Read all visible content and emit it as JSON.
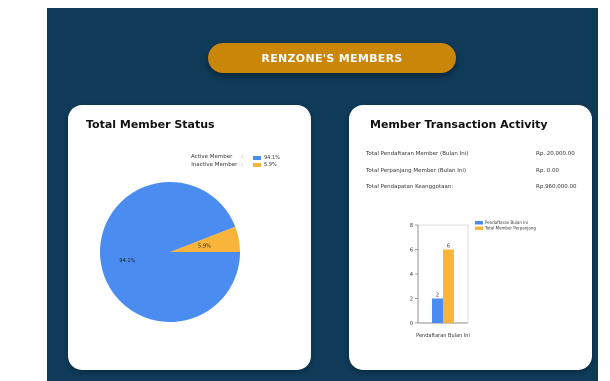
{
  "header": {
    "title": "RENZONE'S MEMBERS"
  },
  "member_status": {
    "title": "Total Member Status",
    "legend": [
      {
        "label": "Active Member",
        "separator": ":",
        "value_label": "94.1%",
        "color": "#4a8cf0"
      },
      {
        "label": "Inactive Member",
        "separator": ":",
        "value_label": "5.9%",
        "color": "#f9b43c"
      }
    ]
  },
  "transactions": {
    "title": "Member Transaction Activity",
    "rows": [
      {
        "label": "Total Pendaftaran Member (Bulan Ini)",
        "value": "Rp. 20,000.00"
      },
      {
        "label": "Total Perpanjang Member (Bulan Ini)",
        "value": "Rp. 0.00"
      },
      {
        "label": "Total Pendapatan Keanggotaan:",
        "value": "Rp.960,000.00"
      }
    ],
    "legend": [
      {
        "name": "Pendaftaran Bulan Ini",
        "color": "#4a8cf0"
      },
      {
        "name": "Total Member Perpanjang",
        "color": "#f9b43c"
      }
    ]
  },
  "chart_data": [
    {
      "type": "pie",
      "slices": [
        {
          "label": "Active Member",
          "value": 94.1,
          "color": "#4a8cf0",
          "data_label": "94.1%"
        },
        {
          "label": "Inactive Member",
          "value": 5.9,
          "color": "#f9b43c",
          "data_label": "5.9%"
        }
      ]
    },
    {
      "type": "bar",
      "categories": [
        "Pendaftaran Bulan Ini"
      ],
      "series": [
        {
          "name": "Pendaftaran Bulan Ini",
          "values": [
            2
          ],
          "color": "#4a8cf0"
        },
        {
          "name": "Total Member Perpanjang",
          "values": [
            6
          ],
          "color": "#f9b43c"
        }
      ],
      "ylim": [
        0,
        8
      ],
      "yticks": [
        0,
        2,
        4,
        6,
        8
      ],
      "legend": "top-right",
      "grid": false
    }
  ]
}
